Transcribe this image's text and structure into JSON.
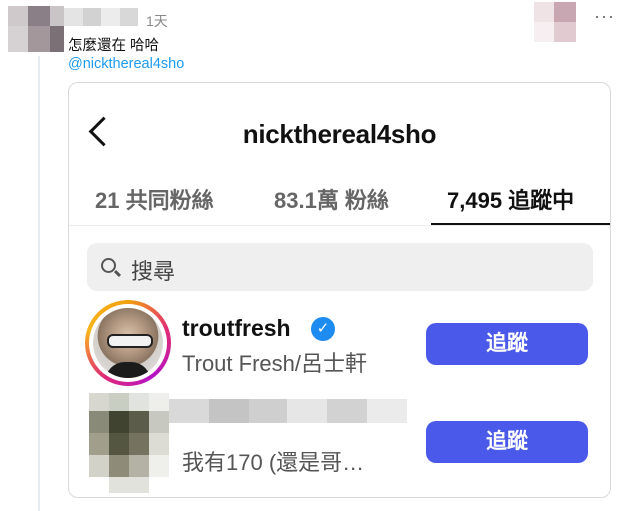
{
  "tweet": {
    "time": "1天",
    "more": "···",
    "text": "怎麼還在 哈哈",
    "mention": "@nickthereal4sho"
  },
  "card": {
    "username": "nickthereal4sho",
    "tabs": [
      {
        "label": "21 共同粉絲"
      },
      {
        "label": "83.1萬 粉絲"
      },
      {
        "label": "7,495 追蹤中"
      }
    ],
    "search_placeholder": "搜尋",
    "accounts": [
      {
        "handle": "troutfresh",
        "display": "Trout Fresh/呂士軒",
        "verified": true,
        "button": "追蹤"
      },
      {
        "display": "我有170 (還是哥…",
        "button": "追蹤"
      }
    ]
  },
  "colors": {
    "accent": "#4a59ea",
    "mention": "#1d9bf0",
    "verified": "#1d8bf0"
  }
}
